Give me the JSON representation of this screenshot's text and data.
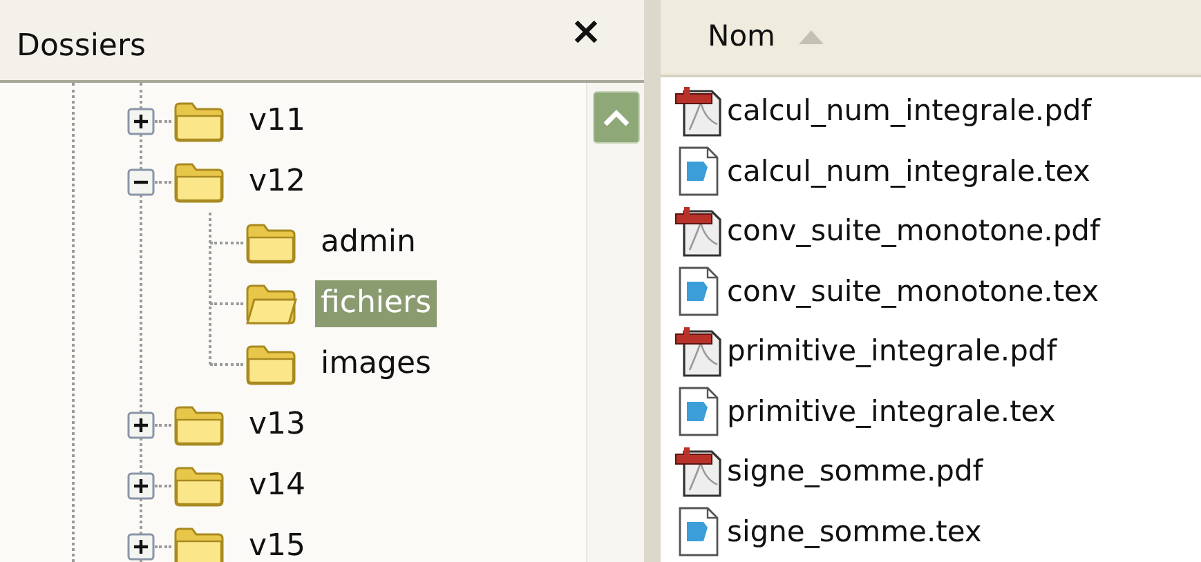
{
  "folders_pane": {
    "title": "Dossiers",
    "tree": [
      {
        "label": "v11",
        "expanded": false,
        "selected": false
      },
      {
        "label": "v12",
        "expanded": true,
        "selected": false,
        "children": [
          {
            "label": "admin",
            "selected": false
          },
          {
            "label": "fichiers",
            "selected": true
          },
          {
            "label": "images",
            "selected": false
          }
        ]
      },
      {
        "label": "v13",
        "expanded": false,
        "selected": false
      },
      {
        "label": "v14",
        "expanded": false,
        "selected": false
      },
      {
        "label": "v15",
        "expanded": false,
        "selected": false
      }
    ]
  },
  "file_list": {
    "column": {
      "label": "Nom",
      "sort_ascending": true
    },
    "files": [
      {
        "name": "calcul_num_integrale.pdf",
        "kind": "pdf"
      },
      {
        "name": "calcul_num_integrale.tex",
        "kind": "tex"
      },
      {
        "name": "conv_suite_monotone.pdf",
        "kind": "pdf"
      },
      {
        "name": "conv_suite_monotone.tex",
        "kind": "tex"
      },
      {
        "name": "primitive_integrale.pdf",
        "kind": "pdf"
      },
      {
        "name": "primitive_integrale.tex",
        "kind": "tex"
      },
      {
        "name": "signe_somme.pdf",
        "kind": "pdf"
      },
      {
        "name": "signe_somme.tex",
        "kind": "tex"
      }
    ]
  }
}
